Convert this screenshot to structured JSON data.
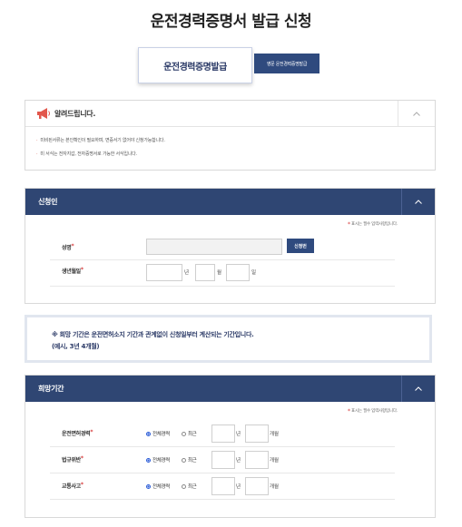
{
  "page_title": "운전경력증명서 발급 신청",
  "tabs": {
    "active": "운전경력증명발급",
    "secondary": "영문 운전경력증명발급"
  },
  "notice": {
    "title": "알려드립니다.",
    "items": [
      "미비된서류는 본인확인이 필요하며, 면증서기 없어야 신청가능합니다.",
      "미 서식는 전자지갑, 전자증명서로 가능한 서식입니다."
    ]
  },
  "applicant": {
    "title": "신청인",
    "required_note": "표시는 필수 입력사항입니다.",
    "name_label": "성명",
    "cert_button": "신청번",
    "birth_label": "생년월일",
    "year_unit": "년",
    "month_unit": "월",
    "day_unit": "일"
  },
  "info": {
    "line1": "※ 희망 기간은 운전면허소지 기간과 관계없이 신청일부터 계산되는 기간입니다.",
    "line2": "(예시, 3년 4개월)"
  },
  "period": {
    "title": "희망기간",
    "required_note": "표시는 필수 입력사항입니다.",
    "rows": [
      {
        "label": "운전면허경력"
      },
      {
        "label": "법규위반"
      },
      {
        "label": "교통사고"
      }
    ],
    "option_all": "전체경력",
    "option_recent": "최근",
    "year_unit": "년",
    "month_unit": "개월"
  },
  "colors": {
    "header_bg": "#2f4673",
    "accent": "#2f4a7e",
    "required_star": "#d63a3a"
  }
}
